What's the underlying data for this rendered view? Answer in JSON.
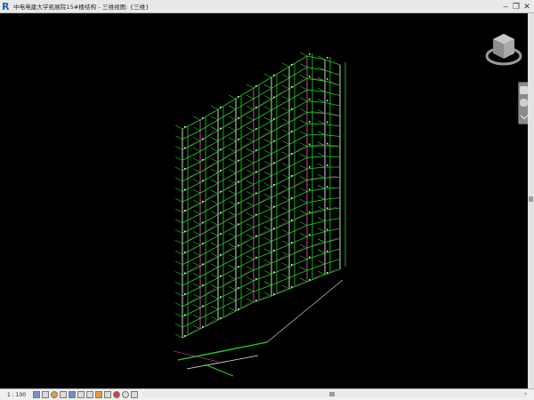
{
  "window": {
    "app_icon": "revit-logo",
    "title": "中电电建大学拓展院15#楼结构 - 三维视图: {三维}",
    "controls": {
      "minimize": "‒",
      "restore": "❐",
      "close": "✕"
    }
  },
  "viewport": {
    "content": "3d-building-mep-model",
    "viewcube_icon": "viewcube-icon",
    "navbar_icons": [
      "steering-wheel-icon",
      "zoom-icon",
      "expand-icon"
    ]
  },
  "statusbar": {
    "scale": "1 : 100",
    "icons": [
      "detail-level-icon",
      "visual-style-icon",
      "sun-path-icon",
      "shadows-icon",
      "render-icon",
      "crop-view-icon",
      "show-crop-icon",
      "lock-3d-icon",
      "temp-hide-icon",
      "reveal-hidden-icon",
      "worksharing-icon",
      "constraints-icon",
      "analytical-icon",
      "highlight-displacement-icon"
    ],
    "left_arrow": "<"
  },
  "colors": {
    "model_green": "#1fd21f",
    "model_white": "#e8e8e8",
    "model_magenta": "#d25aa8",
    "background": "#000000"
  }
}
